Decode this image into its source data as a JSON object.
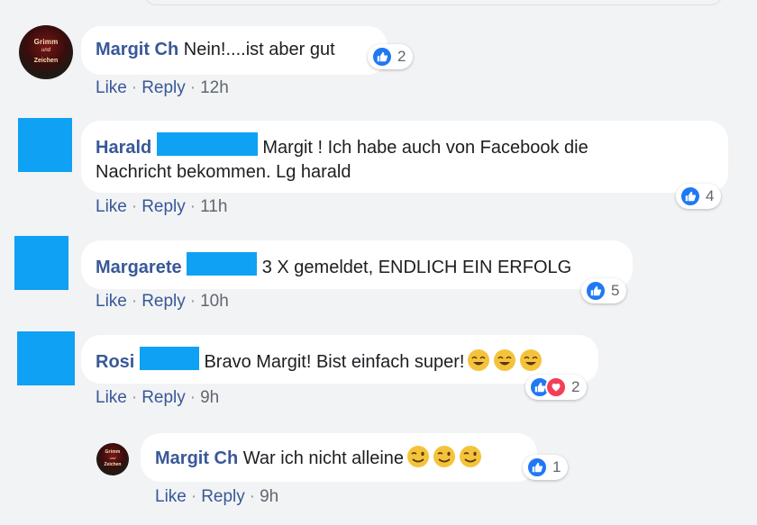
{
  "comments": [
    {
      "author": "Margit Ch",
      "text": "Nein!....ist aber gut",
      "actions": {
        "like": "Like",
        "reply": "Reply",
        "time": "12h"
      },
      "reactions": {
        "count": "2"
      }
    },
    {
      "author": "Harald",
      "text": "Margit ! Ich habe auch von Facebook die",
      "text2": "Nachricht bekommen. Lg harald",
      "actions": {
        "like": "Like",
        "reply": "Reply",
        "time": "11h"
      },
      "reactions": {
        "count": "4"
      }
    },
    {
      "author": "Margarete",
      "text": "3 X gemeldet, ENDLICH EIN ERFOLG",
      "actions": {
        "like": "Like",
        "reply": "Reply",
        "time": "10h"
      },
      "reactions": {
        "count": "5"
      }
    },
    {
      "author": "Rosi",
      "text": "Bravo Margit! Bist einfach super!",
      "actions": {
        "like": "Like",
        "reply": "Reply",
        "time": "9h"
      },
      "reactions": {
        "count": "2"
      }
    },
    {
      "author": "Margit Ch",
      "text": "War ich nicht alleine",
      "actions": {
        "like": "Like",
        "reply": "Reply",
        "time": "9h"
      },
      "reactions": {
        "count": "1"
      }
    }
  ],
  "avatar_logo": {
    "top": "Grimm",
    "mid": "und",
    "bottom": "Zeichen"
  },
  "colors": {
    "author": "#385898",
    "like": "#2078f4",
    "love": "#f33e58",
    "redaction": "#0fa1f3",
    "bubble": "#ffffff",
    "background": "#f2f3f5"
  },
  "icons": {
    "like": "thumbs-up-icon",
    "love": "heart-icon",
    "emoji_grin": "grinning-face-icon",
    "emoji_smile": "smiling-face-icon"
  }
}
